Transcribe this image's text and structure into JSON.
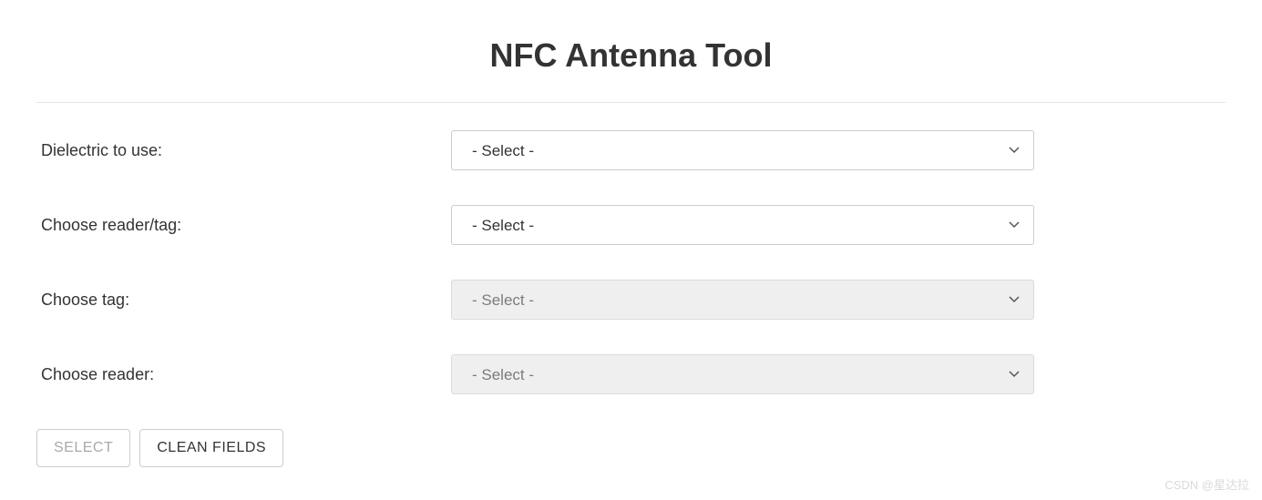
{
  "title": "NFC Antenna Tool",
  "form": {
    "rows": [
      {
        "label": "Dielectric to use:",
        "selected": "- Select -",
        "disabled": false
      },
      {
        "label": "Choose reader/tag:",
        "selected": "- Select -",
        "disabled": false
      },
      {
        "label": "Choose tag:",
        "selected": "- Select -",
        "disabled": true
      },
      {
        "label": "Choose reader:",
        "selected": "- Select -",
        "disabled": true
      }
    ]
  },
  "buttons": {
    "select": "SELECT",
    "clean": "CLEAN FIELDS"
  },
  "watermark": "CSDN @星达拉"
}
